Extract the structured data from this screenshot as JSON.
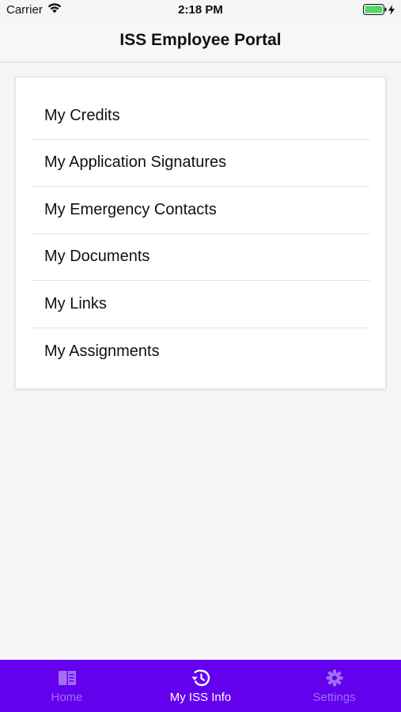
{
  "status_bar": {
    "carrier": "Carrier",
    "time": "2:18 PM"
  },
  "nav": {
    "title": "ISS Employee Portal"
  },
  "menu": {
    "items": [
      {
        "label": "My Credits"
      },
      {
        "label": "My Application Signatures"
      },
      {
        "label": "My Emergency Contacts"
      },
      {
        "label": "My Documents"
      },
      {
        "label": "My Links"
      },
      {
        "label": "My Assignments"
      }
    ]
  },
  "tab_bar": {
    "background": "#6300ee",
    "tabs": [
      {
        "label": "Home",
        "icon": "book-icon",
        "active": false
      },
      {
        "label": "My ISS Info",
        "icon": "history-icon",
        "active": true
      },
      {
        "label": "Settings",
        "icon": "gear-icon",
        "active": false
      }
    ]
  },
  "colors": {
    "accent": "#6300ee",
    "tab_active": "#ffffff",
    "tab_inactive": "#a06ef5",
    "battery": "#4cd964"
  }
}
